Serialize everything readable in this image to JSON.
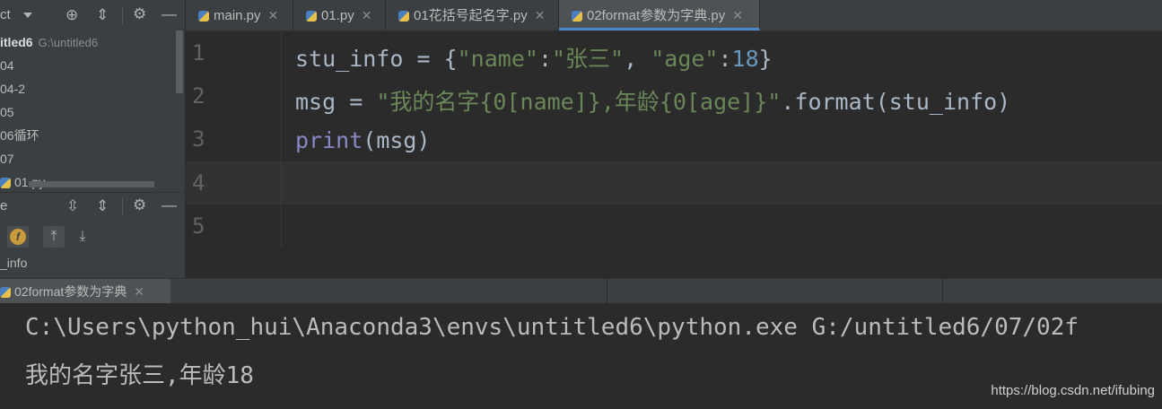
{
  "project_panel": {
    "title": "ct",
    "tree": [
      {
        "label": "itled6",
        "path": "G:\\untitled6"
      },
      {
        "label": "04"
      },
      {
        "label": "04-2"
      },
      {
        "label": "05"
      },
      {
        "label": "06循环"
      },
      {
        "label": "07"
      },
      {
        "label": "01.py"
      }
    ]
  },
  "structure_panel": {
    "title": "e",
    "item": "_info"
  },
  "tabs": [
    {
      "label": "main.py",
      "active": false
    },
    {
      "label": "01.py",
      "active": false
    },
    {
      "label": "01花括号起名字.py",
      "active": false
    },
    {
      "label": "02format参数为字典.py",
      "active": true
    }
  ],
  "editor": {
    "line_numbers": [
      "1",
      "2",
      "3",
      "4",
      "5"
    ],
    "lines": [
      [
        [
          "plain",
          "stu_info = {"
        ],
        [
          "s",
          "\"name\""
        ],
        [
          "plain",
          ":"
        ],
        [
          "s",
          "\"张三\""
        ],
        [
          "plain",
          ", "
        ],
        [
          "s",
          "\"age\""
        ],
        [
          "plain",
          ":"
        ],
        [
          "n",
          "18"
        ],
        [
          "plain",
          "}"
        ]
      ],
      [
        [
          "plain",
          "msg = "
        ],
        [
          "s",
          "\"我的名字{0[name]},年龄{0[age]}\""
        ],
        [
          "plain",
          ".format(stu_info)"
        ]
      ],
      [
        [
          "k",
          "print"
        ],
        [
          "plain",
          "(msg)"
        ]
      ],
      [],
      []
    ]
  },
  "run_panel": {
    "tab_label": "02format参数为字典",
    "output": [
      "C:\\Users\\python_hui\\Anaconda3\\envs\\untitled6\\python.exe G:/untitled6/07/02f",
      "我的名字张三,年龄18"
    ]
  },
  "watermark": "https://blog.csdn.net/ifubing",
  "colors": {
    "string": "#6a8759",
    "number": "#6897bb",
    "builtin": "#8888c6",
    "plain": "#a9b7c6",
    "accent": "#4a88c7"
  }
}
